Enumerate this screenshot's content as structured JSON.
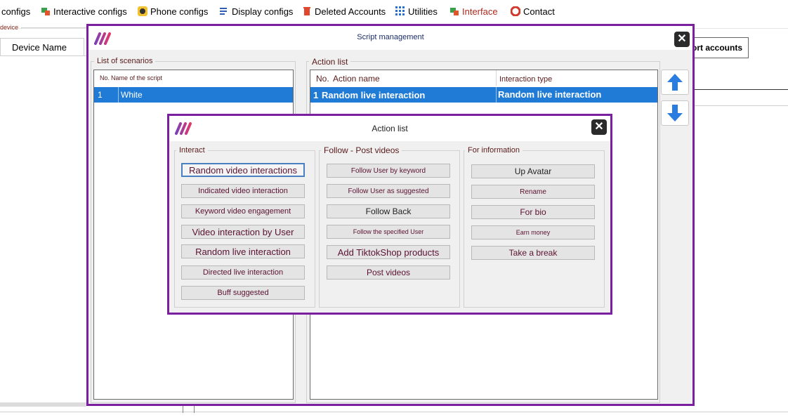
{
  "menubar": {
    "items": [
      {
        "label": "configs",
        "icon": "gear-icon"
      },
      {
        "label": "Interactive configs",
        "icon": "interactive-icon"
      },
      {
        "label": "Phone configs",
        "icon": "phone-icon"
      },
      {
        "label": "Display configs",
        "icon": "display-icon"
      },
      {
        "label": "Deleted Accounts",
        "icon": "trash-icon"
      },
      {
        "label": "Utilities",
        "icon": "grid-icon"
      },
      {
        "label": "Interface",
        "icon": "interface-icon"
      },
      {
        "label": "Contact",
        "icon": "lifebuoy-icon"
      }
    ]
  },
  "background": {
    "device_label": "device",
    "device_name_header": "Device Name",
    "export_label": "ort accounts"
  },
  "script_window": {
    "title": "Script management",
    "scenarios_title": "List of scenarios",
    "scenarios_head_no": "No.",
    "scenarios_head_name": "Name of the script",
    "scenarios_rows": [
      {
        "no": "1",
        "name": "White"
      }
    ],
    "actions_title": "Action list",
    "actions_head_no": "No.",
    "actions_head_name": "Action name",
    "actions_head_type": "Interaction type",
    "actions_rows": [
      {
        "no": "1",
        "name": "Random live interaction",
        "type": "Random live interaction"
      }
    ]
  },
  "action_dialog": {
    "title": "Action list",
    "groups": {
      "interact": "Interact",
      "follow": "Follow - Post videos",
      "info": "For information"
    },
    "interact_buttons": [
      "Random video interactions",
      "Indicated video interaction",
      "Keyword video engagement",
      "Video interaction by User",
      "Random live interaction",
      "Directed live interaction",
      "Buff suggested"
    ],
    "follow_buttons": [
      "Follow User by keyword",
      "Follow User as suggested",
      "Follow Back",
      "Follow the specified User",
      "Add TiktokShop products",
      "Post videos"
    ],
    "info_buttons": [
      "Up Avatar",
      "Rename",
      "For bio",
      "Earn money",
      "Take a break"
    ]
  },
  "colors": {
    "accent": "#7a1fa0",
    "selection": "#1f7bd6",
    "button_text": "#5a1230"
  }
}
